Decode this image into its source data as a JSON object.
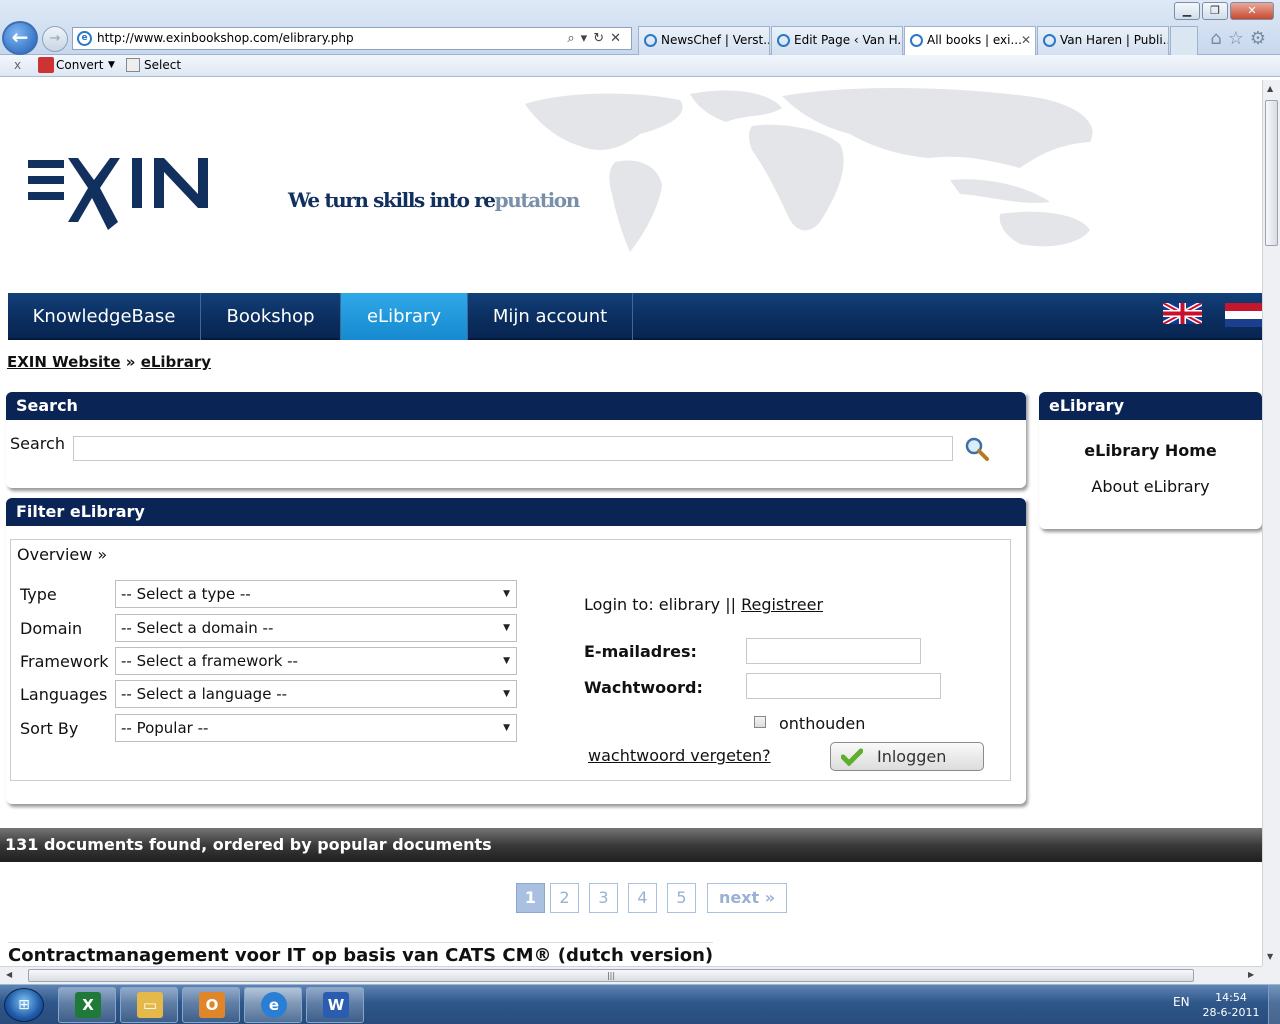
{
  "browser": {
    "url": "http://www.exinbookshop.com/elibrary.php",
    "tabs": [
      {
        "label": "NewsChef | Verst..."
      },
      {
        "label": "Edit Page ‹ Van H..."
      },
      {
        "label": "All books | exi...",
        "active": true
      },
      {
        "label": "Van Haren | Publi..."
      }
    ],
    "command_bar": {
      "close": "x",
      "convert": "Convert",
      "select": "Select"
    }
  },
  "header": {
    "logo_text": "EXIN",
    "tagline_main": "We turn skills into re",
    "tagline_tail": "putation"
  },
  "nav": {
    "items": [
      {
        "label": "KnowledgeBase"
      },
      {
        "label": "Bookshop"
      },
      {
        "label": "eLibrary",
        "active": true
      },
      {
        "label": "Mijn account"
      }
    ]
  },
  "breadcrumb": {
    "home": "EXIN Website",
    "separator": "»",
    "current": "eLibrary"
  },
  "search": {
    "title": "Search",
    "label": "Search",
    "value": ""
  },
  "filter": {
    "title": "Filter eLibrary",
    "overview": "Overview »",
    "fields": [
      {
        "label": "Type",
        "selected": "-- Select a type --"
      },
      {
        "label": "Domain",
        "selected": "-- Select a domain --"
      },
      {
        "label": "Framework",
        "selected": "-- Select a framework --"
      },
      {
        "label": "Languages",
        "selected": "-- Select a language --"
      },
      {
        "label": "Sort By",
        "selected": "-- Popular --"
      }
    ]
  },
  "login": {
    "prefix": "Login to: elibrary ||",
    "register": "Registreer",
    "email_label": "E-mailadres:",
    "password_label": "Wachtwoord:",
    "remember": "onthouden",
    "forgot": "wachtwoord vergeten?",
    "submit": "Inloggen"
  },
  "sidebar": {
    "title": "eLibrary",
    "home": "eLibrary Home",
    "about": "About eLibrary"
  },
  "results": {
    "summary": "131 documents found, ordered by popular documents",
    "pages": [
      "1",
      "2",
      "3",
      "4",
      "5"
    ],
    "current_page": "1",
    "next": "next »",
    "first_title": "Contractmanagement voor IT op basis van CATS CM® (dutch version)"
  },
  "taskbar": {
    "lang": "EN",
    "time": "14:54",
    "date": "28-6-2011"
  },
  "colors": {
    "nav_bg": "#0b2f60",
    "nav_active": "#1f9be0",
    "panel_head": "#0b2456",
    "brand_blue": "#12305e"
  }
}
